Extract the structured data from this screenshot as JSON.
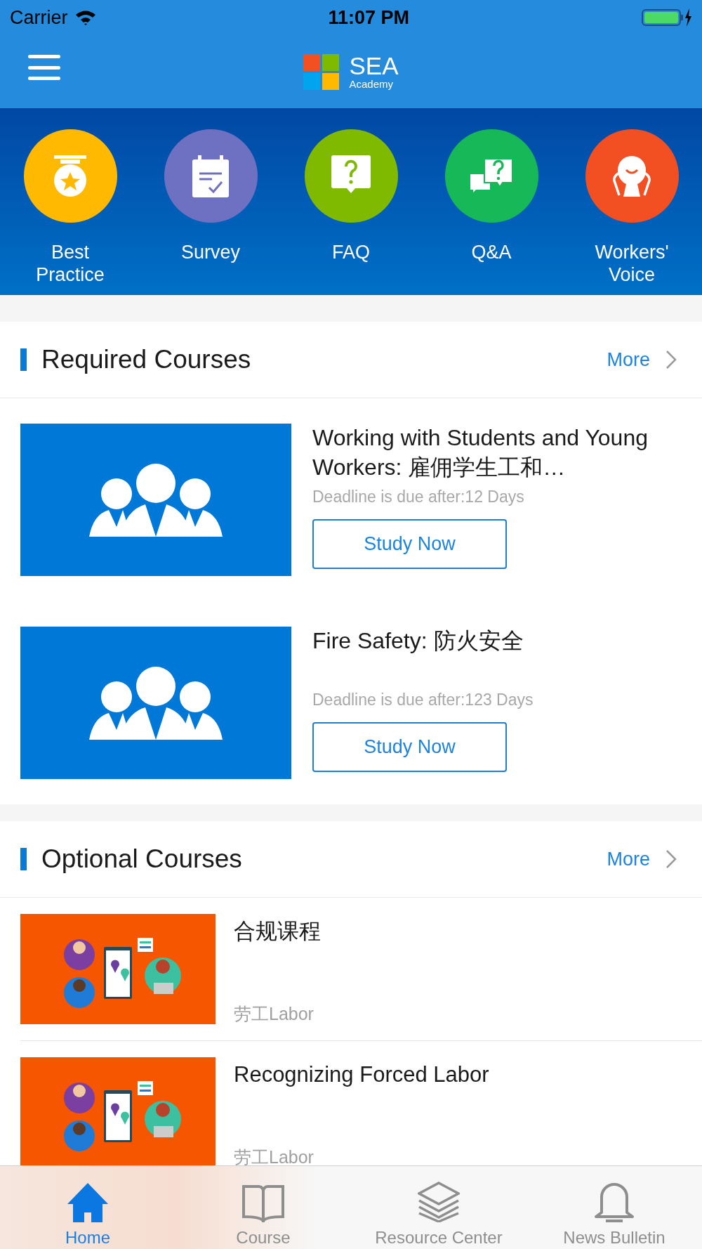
{
  "status_bar": {
    "carrier": "Carrier",
    "time": "11:07 PM"
  },
  "header": {
    "logo_title": "SEA",
    "logo_subtitle": "Academy"
  },
  "quick_links": [
    {
      "label": "Best Practice",
      "color": "#ffb900"
    },
    {
      "label": "Survey",
      "color": "#6e71c1"
    },
    {
      "label": "FAQ",
      "color": "#7fba00"
    },
    {
      "label": "Q&A",
      "color": "#16b857"
    },
    {
      "label": "Workers' Voice",
      "color": "#f25022"
    }
  ],
  "sections": [
    {
      "kind": "required",
      "title": "Required Courses",
      "more": "More",
      "courses": [
        {
          "title": "Working with Students and Young Workers: 雇佣学生工和…",
          "deadline": "Deadline is due after:12 Days",
          "button": "Study Now"
        },
        {
          "title": "Fire Safety: 防火安全",
          "deadline": "Deadline is due after:123 Days",
          "button": "Study Now"
        }
      ]
    },
    {
      "kind": "optional",
      "title": "Optional Courses",
      "more": "More",
      "courses": [
        {
          "title": "合规课程",
          "category": "劳工Labor"
        },
        {
          "title": "Recognizing Forced Labor",
          "category": "劳工Labor"
        }
      ]
    }
  ],
  "tab_bar": [
    {
      "label": "Home",
      "selected": true
    },
    {
      "label": "Course",
      "selected": false
    },
    {
      "label": "Resource Center",
      "selected": false
    },
    {
      "label": "News Bulletin",
      "selected": false
    }
  ]
}
